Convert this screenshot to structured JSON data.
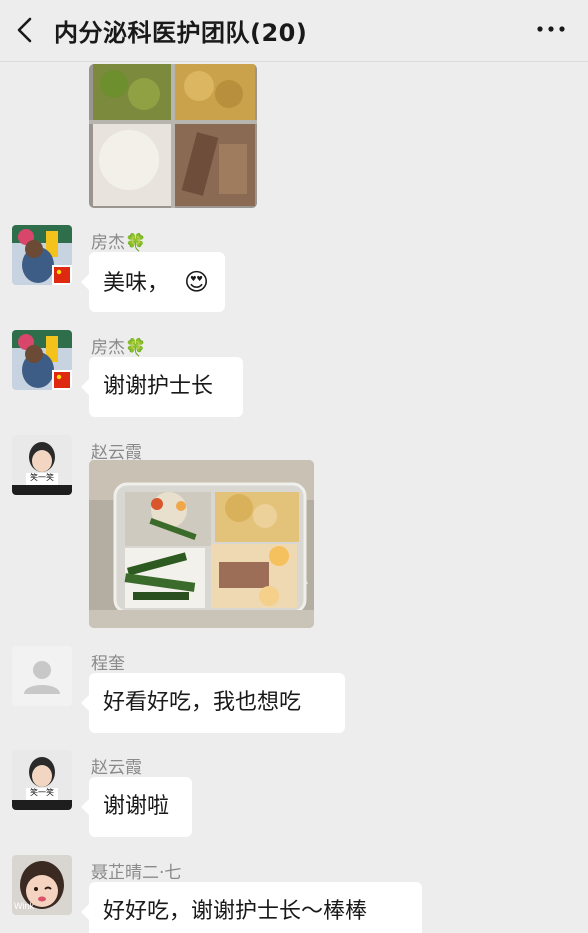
{
  "header": {
    "title": "内分泌科医护团队(20)",
    "back_icon": "chevron-left-icon",
    "more_icon": "more-dots-icon"
  },
  "messages": [
    {
      "type": "image",
      "content": "food-tray-photo"
    },
    {
      "sender": "房杰🍀",
      "text": "美味，",
      "emoji": "😍"
    },
    {
      "sender": "房杰🍀",
      "text": "谢谢护士长"
    },
    {
      "sender": "赵云霞",
      "type": "image",
      "avatar_caption": "笑一笑"
    },
    {
      "sender": "程奎",
      "text": "好看好吃，我也想吃"
    },
    {
      "sender": "赵云霞",
      "text": "谢谢啦",
      "avatar_caption": "笑一笑"
    },
    {
      "sender": "聂芷晴二·七",
      "text": "好好吃，谢谢护士长～棒棒",
      "avatar_caption": "Wink"
    }
  ],
  "colors": {
    "background": "#ededed",
    "bubble": "#ffffff",
    "sender_name": "#8a8a8a",
    "text": "#191919"
  }
}
